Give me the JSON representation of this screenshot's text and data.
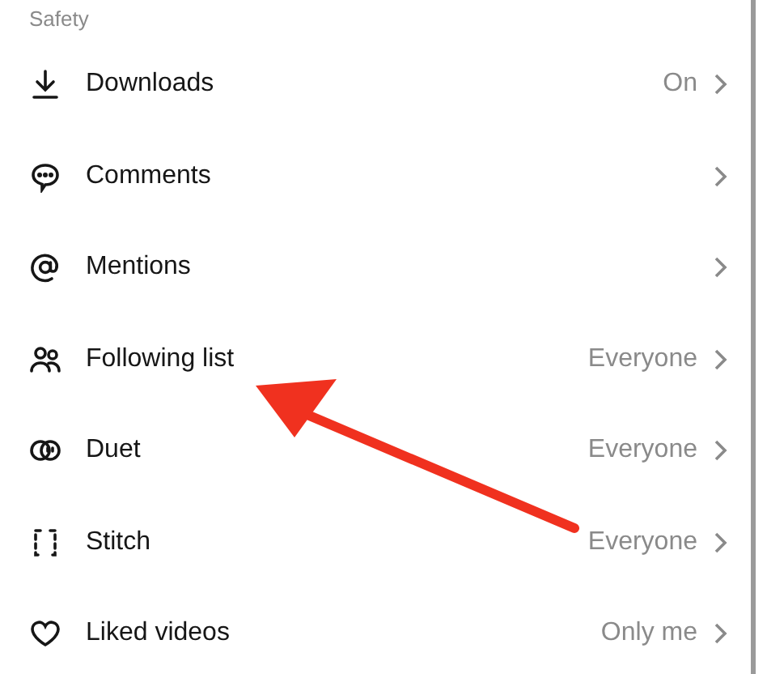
{
  "section": {
    "title": "Safety"
  },
  "items": [
    {
      "label": "Downloads",
      "value": "On"
    },
    {
      "label": "Comments"
    },
    {
      "label": "Mentions"
    },
    {
      "label": "Following list",
      "value": "Everyone"
    },
    {
      "label": "Duet",
      "value": "Everyone"
    },
    {
      "label": "Stitch",
      "value": "Everyone"
    },
    {
      "label": "Liked videos",
      "value": "Only me"
    }
  ]
}
